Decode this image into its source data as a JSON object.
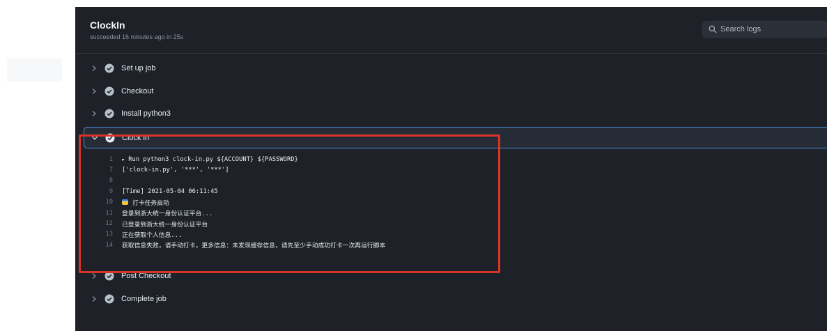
{
  "header": {
    "title": "ClockIn",
    "status": "succeeded 16 minutes ago in 25s"
  },
  "search": {
    "placeholder": "Search logs"
  },
  "steps": [
    {
      "label": "Set up job"
    },
    {
      "label": "Checkout"
    },
    {
      "label": "Install python3"
    },
    {
      "label": "Clock in"
    },
    {
      "label": "Post Checkout"
    },
    {
      "label": "Complete job"
    }
  ],
  "log": [
    {
      "num": "1",
      "text": "Run python3 clock-in.py ${ACCOUNT} ${PASSWORD}",
      "expander": "►"
    },
    {
      "num": "7",
      "text": "['clock-in.py', '***', '***']"
    },
    {
      "num": "8",
      "text": ""
    },
    {
      "num": "9",
      "text": "[Time] 2021-05-04 06:11:45"
    },
    {
      "num": "10",
      "text": "打卡任务启动",
      "icon": "calendar-emoji-icon"
    },
    {
      "num": "11",
      "text": "登录到浙大统一身份认证平台..."
    },
    {
      "num": "12",
      "text": "已登录到浙大统一身份认证平台"
    },
    {
      "num": "13",
      "text": "正在获取个人信息..."
    },
    {
      "num": "14",
      "text": "获取信息失败，请手动打卡，更多信息：未发现缓存信息，请先至少手动成功打卡一次再运行脚本"
    }
  ],
  "colors": {
    "panel_bg": "#1e2228",
    "expanded_border": "#4c8ed9",
    "success_check": "#b8c0ca",
    "annotation": "#d8342a"
  },
  "icons": {
    "search": "search-icon",
    "collapsed": "chevron-right-icon",
    "expanded": "chevron-down-icon",
    "success": "check-circle-icon"
  }
}
